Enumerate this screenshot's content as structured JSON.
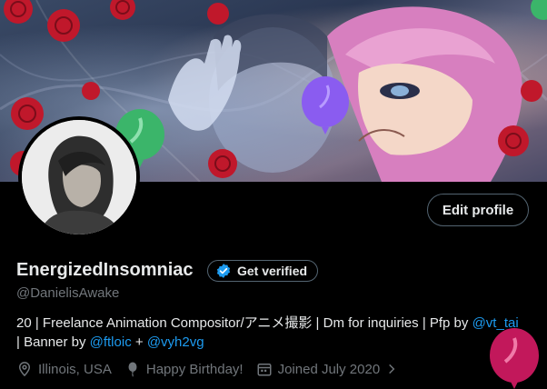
{
  "profile": {
    "display_name": "EnergizedInsomniac",
    "handle": "@DanielisAwake",
    "edit_label": "Edit profile",
    "verify_label": "Get verified",
    "bio": {
      "text_1": "20 | Freelance Animation Compositor/アニメ撮影 | Dm for inquiries | Pfp by ",
      "link_1": "@vt_tai",
      "text_2": "| Banner by ",
      "link_2": "@ftloic",
      "text_3": " + ",
      "link_3": "@vyh2vg"
    },
    "meta": {
      "location": "Illinois, USA",
      "birthday": "Happy Birthday!",
      "joined": "Joined July 2020"
    }
  },
  "colors": {
    "background": "#000000",
    "text": "#e7e9ea",
    "muted": "#71767b",
    "link": "#1d9bf0",
    "border": "#536471",
    "balloon_green": "#3bb56a",
    "balloon_purple": "#8a5cf0",
    "balloon_pink": "#c2185b"
  },
  "icons": [
    "verified-badge-icon",
    "location-pin-icon",
    "balloon-icon",
    "calendar-icon",
    "chevron-right-icon",
    "birthday-balloon-icon"
  ]
}
